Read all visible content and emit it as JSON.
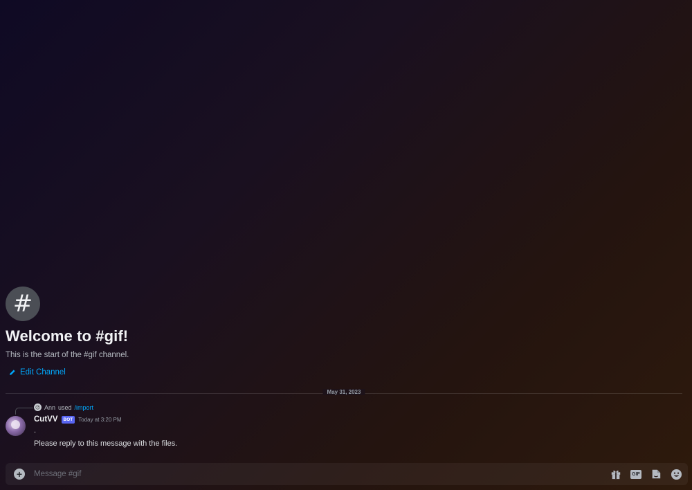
{
  "welcome": {
    "channel_icon": "#",
    "title": "Welcome to #gif!",
    "subtitle": "This is the start of the #gif channel.",
    "edit_label": "Edit Channel"
  },
  "divider": {
    "date": "May 31, 2023"
  },
  "message": {
    "reply_user": "Ann",
    "reply_action": "used",
    "reply_command": "/import",
    "author": "CutVV",
    "tag": "BOT",
    "timestamp": "Today at 3:20 PM",
    "line1": ".",
    "line2": "Please reply to this message with the files."
  },
  "composer": {
    "placeholder": "Message #gif",
    "gif_label": "GIF",
    "icons": [
      "add-icon",
      "gift-icon",
      "gif-icon",
      "sticker-icon",
      "emoji-icon"
    ]
  },
  "colors": {
    "accent_link": "#00a8fc",
    "bot_tag": "#5865f2"
  }
}
